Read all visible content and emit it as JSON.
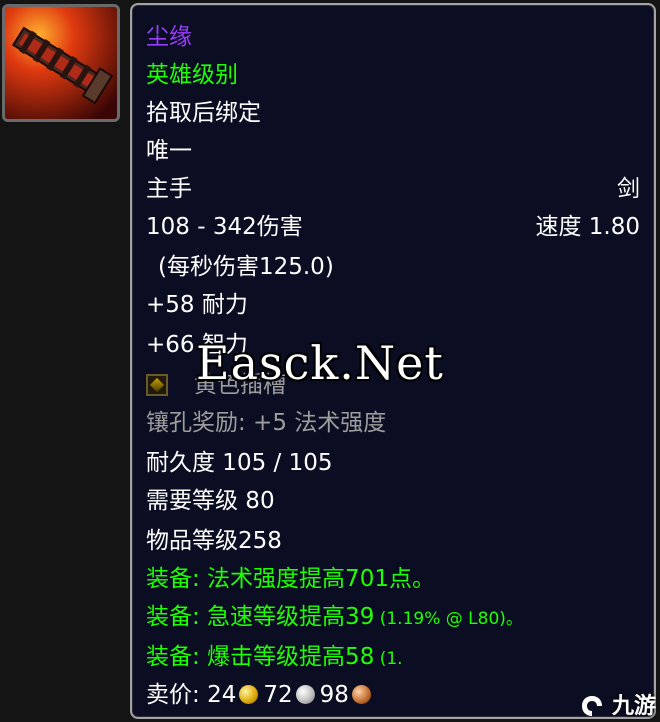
{
  "item": {
    "name": "尘缘",
    "quality": "英雄级别",
    "bind": "拾取后绑定",
    "unique": "唯一",
    "slot": "主手",
    "weapon_type": "剑",
    "damage": "108 - 342伤害",
    "speed": "速度 1.80",
    "dps": "(每秒伤害125.0)",
    "stat1": "+58 耐力",
    "stat2": "+66 智力",
    "socket": "黄色插槽",
    "socket_bonus": "镶孔奖励: +5 法术强度",
    "durability": "耐久度 105 / 105",
    "req_level": "需要等级 80",
    "item_level": "物品等级258",
    "equip1": "装备:  法术强度提高701点。",
    "equip2_main": "装备:  急速等级提高39",
    "equip2_note": " (1.19% @ L80)。",
    "equip3_main": "装备:  爆击等级提高58",
    "equip3_note": " (1.",
    "sell_label": "卖价: ",
    "sell_gold": "24",
    "sell_silver": "72",
    "sell_copper": "98"
  },
  "watermark": "Easck.Net",
  "brand": "九游",
  "colors": {
    "epic": "#9a3cff",
    "heroic_green": "#1eff00",
    "disabled_grey": "#9d9d9d",
    "tooltip_bg": "#0b0e22"
  }
}
